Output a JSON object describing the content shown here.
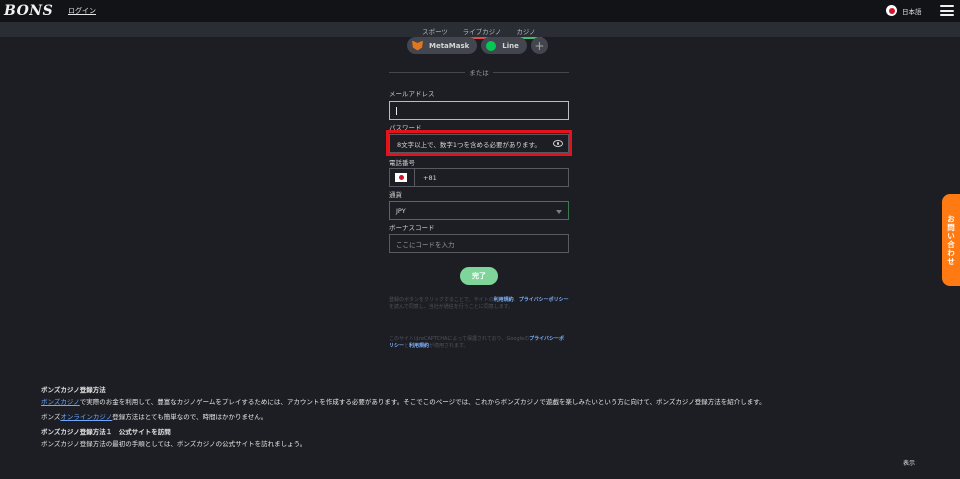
{
  "header": {
    "logo": "BONS",
    "login_label": "ログイン",
    "language_label": "日本語"
  },
  "subnav": {
    "tabs": [
      {
        "label": "スポーツ",
        "color": "#4aa3ff"
      },
      {
        "label": "ライブカジノ",
        "color": "#e34a4a"
      },
      {
        "label": "カジノ",
        "color": "#3fc16a"
      }
    ]
  },
  "oauth": {
    "metamask_label": "MetaMask",
    "line_label": "Line",
    "more_label": "+"
  },
  "form": {
    "or_text": "または",
    "email": {
      "label": "メールアドレス",
      "value": ""
    },
    "password": {
      "label": "パスワード",
      "hint": "8文字以上で、数字1つを含める必要があります。"
    },
    "phone": {
      "label": "電話番号",
      "code": "+81"
    },
    "currency": {
      "label": "通貨",
      "value": "JPY"
    },
    "bonus": {
      "label": "ボーナスコード",
      "placeholder": "ここにコードを入力"
    },
    "submit_label": "完了"
  },
  "legal": {
    "para1_prefix": "登録のボタンをクリックすることで、サイトの",
    "terms_link": "利用規約",
    "privacy_link_1": "プライバシーポリシー",
    "para1_suffix": "を読んで同意し、当社が通信を行うことに同意します。",
    "para2_prefix": "このサイトはreCAPTCHAによって保護されており、Googleの",
    "privacy_link_2": "プライバシーポリシー",
    "terms_link_2": "利用規約",
    "para2_suffix": "が適用されます。"
  },
  "article": {
    "heading": "ボンズカジノ登録方法",
    "line1_link": "ボンズカジノ",
    "line1_text": "で実際のお金を利用して、豊富なカジノゲームをプレイするためには、アカウントを作成する必要があります。そこでこのページでは、これからボンズカジノで遊戯を楽しみたいという方に向けて、ボンズカジノ登録方法を紹介します。",
    "line2_prefix": "ボンズ",
    "line2_link": "オンラインカジノ",
    "line2_suffix": "登録方法はとても簡単なので、時間はかかりません。",
    "step1_heading": "ボンズカジノ登録方法１　公式サイトを訪問",
    "step1_text": "ボンズカジノ登録方法の最初の手順としては、ボンズカジノの公式サイトを訪れましょう。"
  },
  "contact_tab_label": "お問い合わせ",
  "display_label": "表示"
}
